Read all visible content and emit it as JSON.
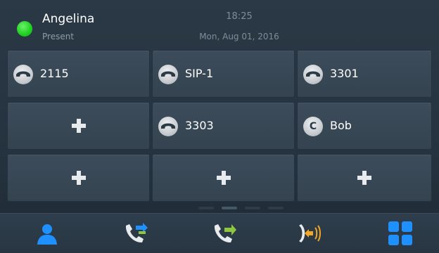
{
  "header": {
    "user_name": "Angelina",
    "presence": "Present",
    "time": "18:25",
    "date": "Mon, Aug 01, 2016",
    "presence_color": "#22d322"
  },
  "keys": [
    {
      "label": "2115",
      "icon": "handset-icon"
    },
    {
      "label": "SIP-1",
      "icon": "handset-icon"
    },
    {
      "label": "3301",
      "icon": "handset-icon"
    },
    {
      "label": "",
      "icon": "plus-icon"
    },
    {
      "label": "3303",
      "icon": "handset-icon"
    },
    {
      "label": "Bob",
      "icon": "contact-c-icon",
      "badge": "C"
    },
    {
      "label": "",
      "icon": "plus-icon"
    },
    {
      "label": "",
      "icon": "plus-icon"
    },
    {
      "label": "",
      "icon": "plus-icon"
    }
  ],
  "pager": {
    "pages": 4,
    "active": 2
  },
  "bottom_bar": {
    "tabs": [
      "contacts-icon",
      "call-transfer-icon",
      "call-forward-icon",
      "pickup-icon",
      "apps-grid-icon"
    ],
    "accent_blue": "#1e90ff",
    "accent_green": "#8ec641",
    "accent_orange": "#f5a623"
  }
}
